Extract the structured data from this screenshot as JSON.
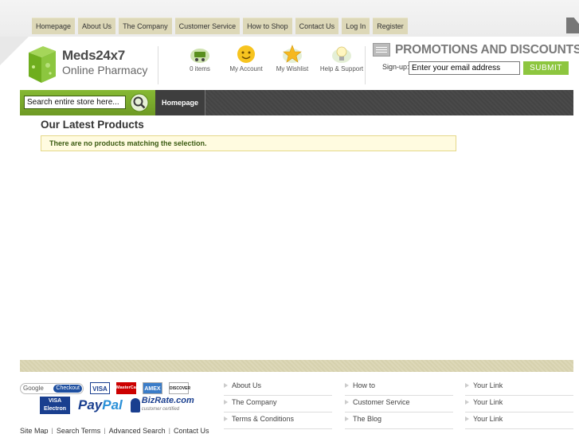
{
  "top_nav": [
    "Homepage",
    "About Us",
    "The Company",
    "Customer Service",
    "How to Shop",
    "Contact Us",
    "Log In",
    "Register"
  ],
  "logo": {
    "name": "Meds24x7",
    "sub": "Online Pharmacy"
  },
  "header_links": {
    "cart": "0 items",
    "account": "My Account",
    "wishlist": "My Wishlist",
    "help": "Help & Support"
  },
  "promo": {
    "title": "PROMOTIONS AND DISCOUNTS",
    "signup_label": "Sign-up:",
    "email_value": "Enter your email address",
    "submit_label": "SUBMIT"
  },
  "search": {
    "value": "Search entire store here..."
  },
  "nav_tabs": [
    "Homepage"
  ],
  "main": {
    "title": "Our Latest Products",
    "notice": "There are no products matching the selection."
  },
  "payments": {
    "google_checkout": "Google",
    "google_checkout_btn": "Checkout",
    "visa": "VISA",
    "mastercard": "MasterCard",
    "amex": "AMEX",
    "discover": "DISCOVER",
    "visa_electron_1": "VISA",
    "visa_electron_2": "Electron",
    "paypal_1": "Pay",
    "paypal_2": "Pal",
    "bizrate": "BizRate.com",
    "bizrate_sub": "customer certified"
  },
  "bottom_links": [
    "Site Map",
    "Search Terms",
    "Advanced Search",
    "Contact Us"
  ],
  "footer_cols": [
    [
      "About Us",
      "The Company",
      "Terms & Conditions"
    ],
    [
      "How to",
      "Customer Service",
      "The Blog"
    ],
    [
      "Your Link",
      "Your Link",
      "Your Link"
    ]
  ]
}
